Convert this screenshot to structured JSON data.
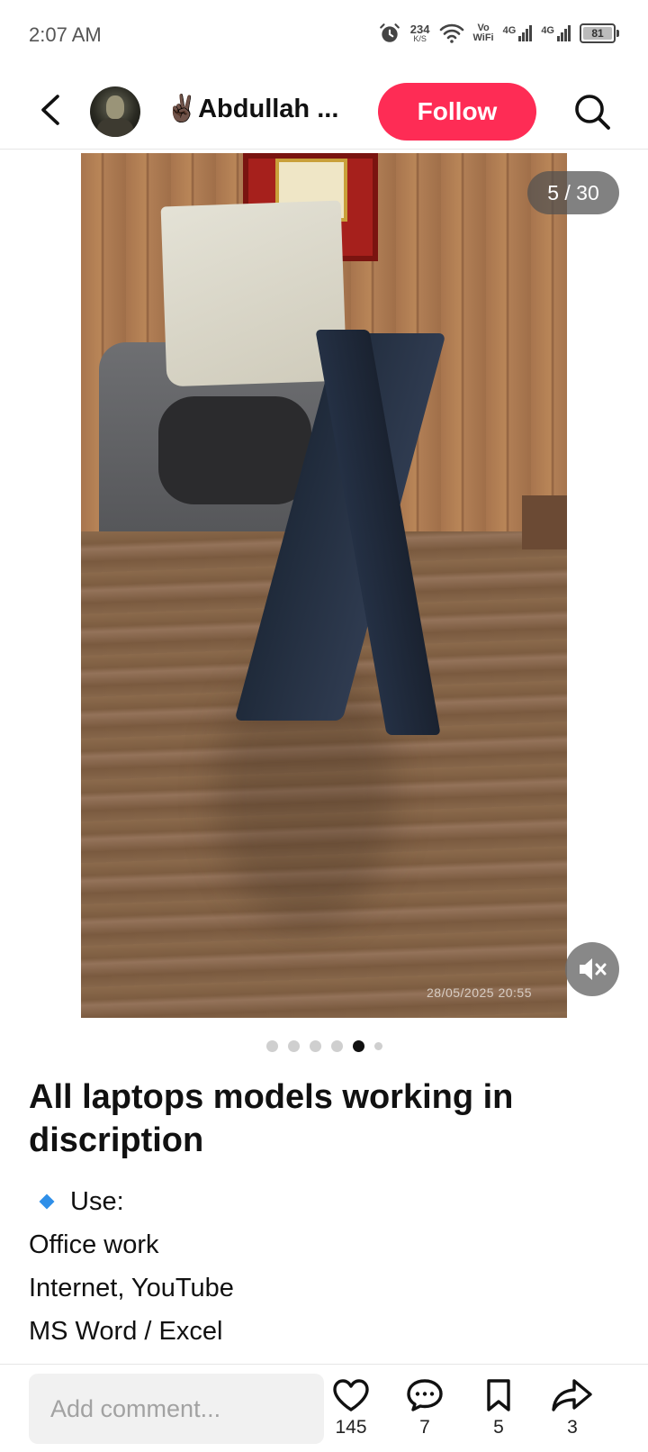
{
  "status_bar": {
    "time": "2:07 AM",
    "speed_value": "234",
    "speed_unit": "K/S",
    "vowifi_top": "Vo",
    "vowifi_bottom": "WiFi",
    "sim1_label": "4G",
    "sim2_label": "4G",
    "battery": "81"
  },
  "header": {
    "username": "✌🏿Abdullah ...",
    "follow_label": "Follow"
  },
  "media": {
    "counter": "5 / 30",
    "timestamp": "28/05/2025 20:55",
    "total_dots": 6,
    "active_dot": 5
  },
  "post": {
    "title": "All laptops models working in discription",
    "use_label": "Use:",
    "lines": [
      "Office work",
      "Internet, YouTube",
      "MS Word / Excel"
    ]
  },
  "bottom_bar": {
    "comment_placeholder": "Add comment...",
    "likes": "145",
    "comments": "7",
    "saves": "5",
    "shares": "3"
  },
  "colors": {
    "follow": "#fe2c55",
    "diamond": "#2f8fe8"
  }
}
